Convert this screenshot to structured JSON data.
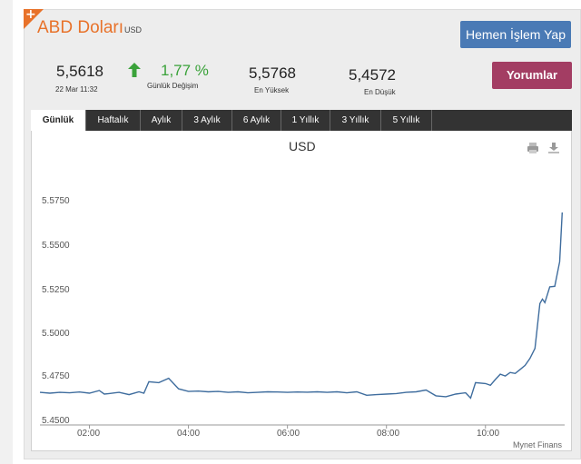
{
  "header": {
    "title": "ABD Doları",
    "code": "USD",
    "trade_button": "Hemen İşlem Yap",
    "comments_button": "Yorumlar"
  },
  "stats": {
    "last": "5,5618",
    "datetime": "22 Mar 11:32",
    "change": "1,77 %",
    "change_label": "Günlük Değişim",
    "high": "5,5768",
    "high_label": "En Yüksek",
    "low": "5,4572",
    "low_label": "En Düşük",
    "accent_up": "#3aa23a"
  },
  "tabs": [
    "Günlük",
    "Haftalık",
    "Aylık",
    "3 Aylık",
    "6 Aylık",
    "1 Yıllık",
    "3 Yıllık",
    "5 Yıllık"
  ],
  "active_tab": "Günlük",
  "icons": {
    "print": "print-icon",
    "download": "download-icon",
    "corner": "plus-icon",
    "arrow": "arrow-up-icon"
  },
  "chart_data": {
    "type": "line",
    "title": "USD",
    "credit": "Mynet Finans",
    "ylim": [
      5.45,
      5.58
    ],
    "yticks": [
      "5.5750",
      "5.5500",
      "5.5250",
      "5.5000",
      "5.4750",
      "5.4500"
    ],
    "ytick_values": [
      5.575,
      5.55,
      5.525,
      5.5,
      5.475,
      5.45
    ],
    "xlim": [
      1.0,
      11.6
    ],
    "xticks": [
      "02:00",
      "04:00",
      "06:00",
      "08:00",
      "10:00"
    ],
    "xtick_values": [
      2,
      4,
      6,
      8,
      10
    ],
    "grid": false,
    "line_color": "#3f6d9e",
    "x": [
      1.0,
      1.2,
      1.4,
      1.6,
      1.8,
      2.0,
      2.2,
      2.3,
      2.4,
      2.6,
      2.8,
      3.0,
      3.1,
      3.2,
      3.4,
      3.6,
      3.8,
      4.0,
      4.2,
      4.4,
      4.6,
      4.8,
      5.0,
      5.2,
      5.4,
      5.6,
      5.8,
      6.0,
      6.2,
      6.4,
      6.6,
      6.8,
      7.0,
      7.2,
      7.4,
      7.6,
      7.8,
      8.0,
      8.2,
      8.4,
      8.6,
      8.8,
      9.0,
      9.2,
      9.4,
      9.6,
      9.7,
      9.8,
      10.0,
      10.1,
      10.2,
      10.3,
      10.4,
      10.5,
      10.6,
      10.7,
      10.8,
      10.9,
      11.0,
      11.1,
      11.15,
      11.2,
      11.3,
      11.4,
      11.5,
      11.55
    ],
    "y": [
      5.4665,
      5.466,
      5.4665,
      5.4662,
      5.4667,
      5.466,
      5.4675,
      5.4655,
      5.4658,
      5.4665,
      5.4652,
      5.4668,
      5.466,
      5.4725,
      5.472,
      5.4745,
      5.4685,
      5.467,
      5.4672,
      5.4668,
      5.467,
      5.4665,
      5.4668,
      5.4662,
      5.4665,
      5.4668,
      5.4667,
      5.4665,
      5.4667,
      5.4666,
      5.4668,
      5.4665,
      5.4668,
      5.4662,
      5.4668,
      5.4648,
      5.4652,
      5.4655,
      5.4658,
      5.4665,
      5.4668,
      5.4678,
      5.4645,
      5.464,
      5.4655,
      5.4662,
      5.4632,
      5.472,
      5.4715,
      5.4705,
      5.4738,
      5.4768,
      5.4758,
      5.4778,
      5.4772,
      5.4795,
      5.4818,
      5.4858,
      5.4915,
      5.517,
      5.5195,
      5.5175,
      5.5265,
      5.5268,
      5.5408,
      5.5688
    ]
  }
}
